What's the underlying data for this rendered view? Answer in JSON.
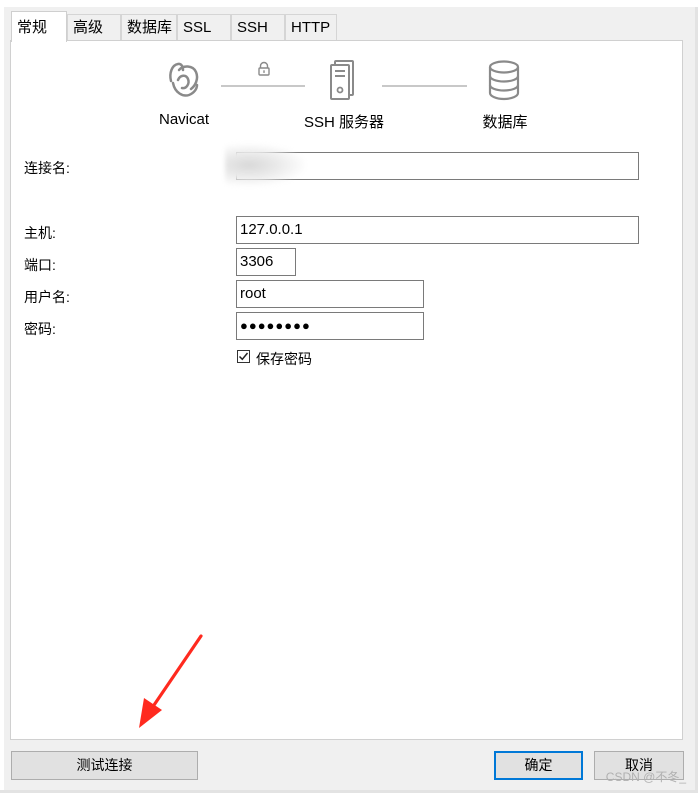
{
  "tabs": [
    "常规",
    "高级",
    "数据库",
    "SSL",
    "SSH",
    "HTTP"
  ],
  "diagram": {
    "client_label": "Navicat",
    "ssh_label": "SSH 服务器",
    "db_label": "数据库"
  },
  "form": {
    "connection_name_label": "连接名:",
    "connection_name_value": "",
    "host_label": "主机:",
    "host_value": "127.0.0.1",
    "port_label": "端口:",
    "port_value": "3306",
    "username_label": "用户名:",
    "username_value": "root",
    "password_label": "密码:",
    "password_value": "●●●●●●●●",
    "save_password_label": "保存密码",
    "save_password_checked": true
  },
  "buttons": {
    "test_connection": "测试连接",
    "ok": "确定",
    "cancel": "取消"
  },
  "watermark": "CSDN @不冬_",
  "colors": {
    "annotation_arrow": "#ff2a1f",
    "primary_button_border": "#0078d7"
  }
}
